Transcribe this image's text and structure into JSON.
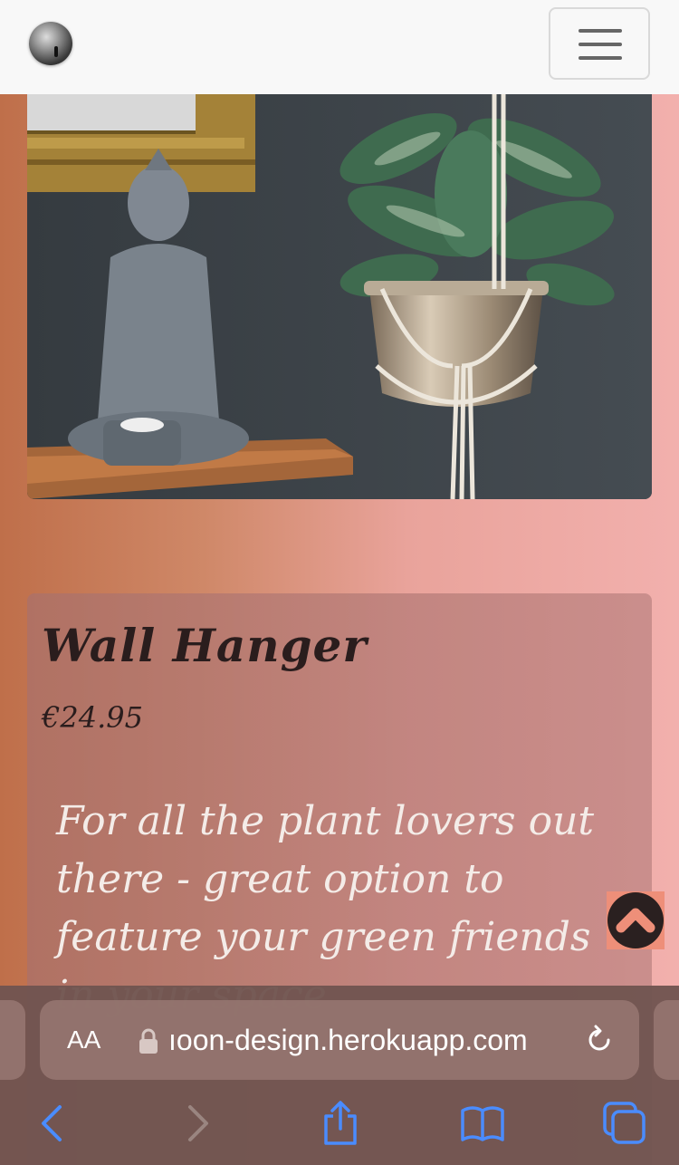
{
  "navbar": {
    "logo_alt": "logo",
    "menu_icon": "hamburger-menu-icon"
  },
  "product": {
    "image_alt": "Macrame wall hanger with plant next to buddha statue",
    "name": "Wall Hanger",
    "price": "€24.95",
    "description": "For all the plant lovers out there - great option to feature your green friends in your space"
  },
  "back_to_top": {
    "icon": "chevron-up-icon"
  },
  "browser": {
    "text_size_label": "AA",
    "url": "ıoon-design.herokuapp.com",
    "icons": [
      "lock-icon",
      "reload-icon",
      "back-icon",
      "forward-icon",
      "share-icon",
      "bookmarks-icon",
      "tabs-icon"
    ],
    "accent_color": "#4a8cff"
  }
}
